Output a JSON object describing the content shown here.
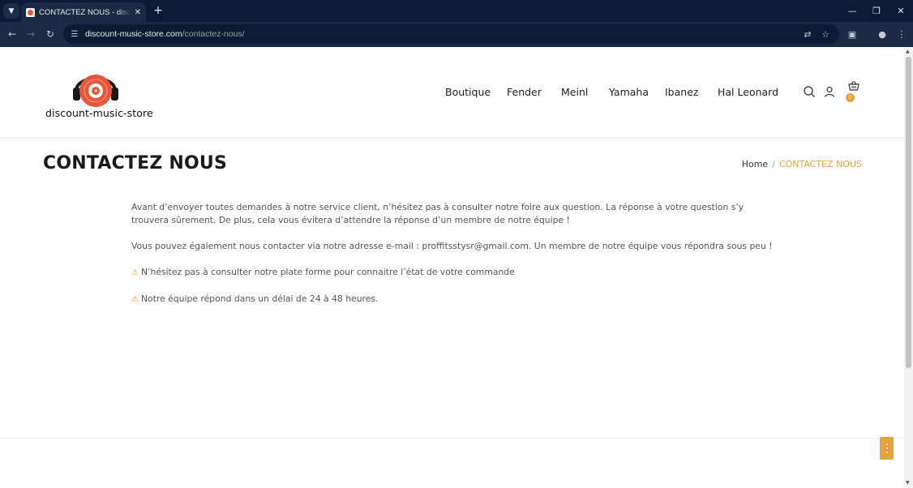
{
  "browser": {
    "tab_title": "CONTACTEZ NOUS - discount-music-store",
    "url_host": "discount-music-store.com",
    "url_path": "/contactez-nous/"
  },
  "site": {
    "logo_text": "discount-music-store",
    "nav": [
      "Boutique",
      "Fender",
      "Meinl",
      "Yamaha",
      "Ibanez",
      "Hal Leonard"
    ],
    "cart_count": "0"
  },
  "page": {
    "title": "CONTACTEZ NOUS",
    "breadcrumb_home": "Home",
    "breadcrumb_sep": "/",
    "breadcrumb_current": "CONTACTEZ NOUS",
    "paragraphs": [
      "Avant d’envoyer toutes demandes à notre service client, n’hésitez pas à consulter notre foire aux question. La réponse à votre question s’y trouvera sûrement. De plus, cela vous évitera d’attendre la réponse d’un membre de notre équipe !",
      "Vous pouvez également nous contacter via notre adresse e-mail : proffitsstysr@gmail.com. Un membre de notre équipe vous répondra sous peu !"
    ],
    "notices": [
      "N’hésitez pas à consulter notre plate forme pour connaitre l’état de votre commande",
      "Notre équipe répond dans un délai de 24 à 48 heures."
    ]
  },
  "colors": {
    "accent": "#e6a23c",
    "logo_orange": "#e8553a",
    "chrome_dark": "#0b1b33",
    "chrome_toolbar": "#1c2b45"
  }
}
